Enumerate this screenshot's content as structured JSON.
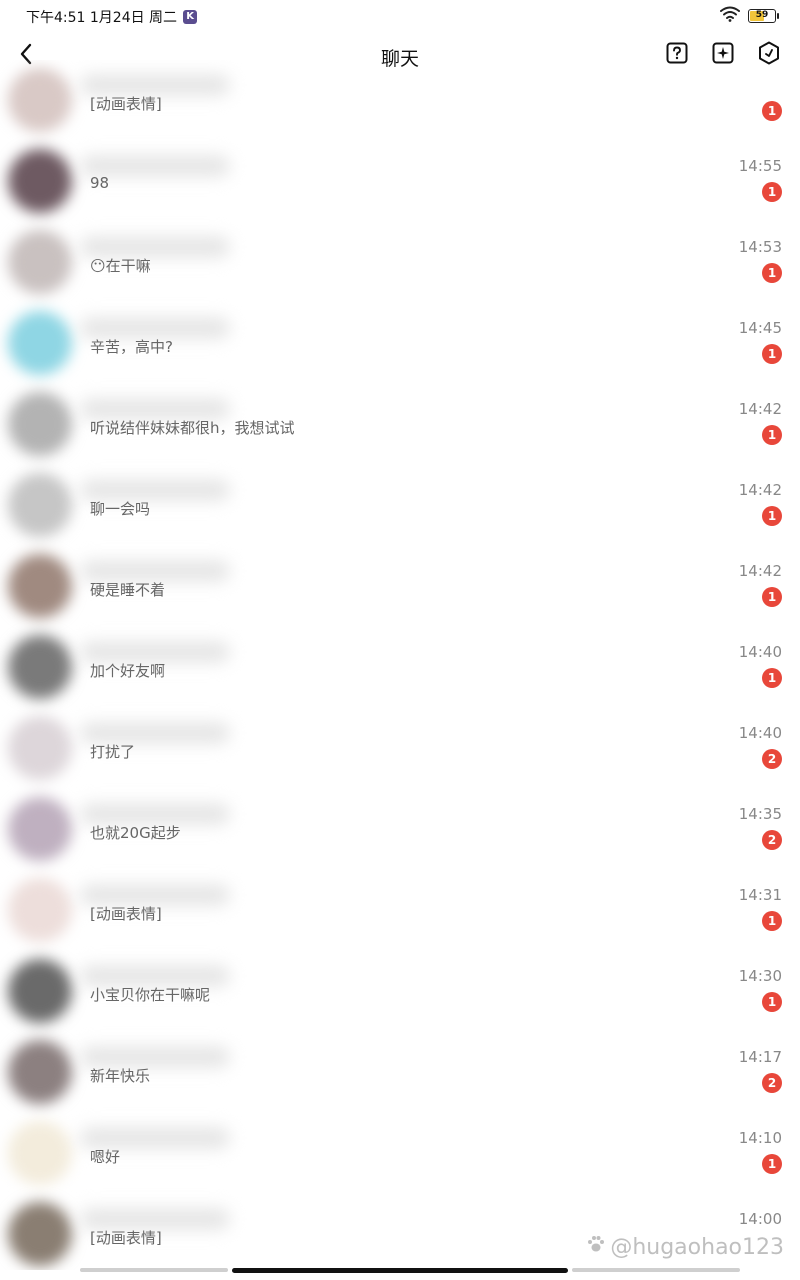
{
  "status_bar": {
    "time_date": "下午4:51  1月24日 周二",
    "app_badge": "K",
    "battery": "59",
    "battery_level": 0.59,
    "icons": [
      "wifi-icon",
      "battery-icon"
    ]
  },
  "nav": {
    "title": "聊天",
    "icons": [
      "back-arrow-icon",
      "help-square-icon",
      "add-square-icon",
      "settings-hex-icon"
    ]
  },
  "chats": [
    {
      "preview": "[动画表情]",
      "time": "",
      "unread": "1",
      "avatar_color": "#d9c9c6"
    },
    {
      "preview": "98",
      "time": "14:55",
      "unread": "1",
      "avatar_color": "#6e5a62"
    },
    {
      "preview": "😶在干嘛",
      "time": "14:53",
      "unread": "1",
      "avatar_color": "#c9c1c0"
    },
    {
      "preview": "辛苦，高中?",
      "time": "14:45",
      "unread": "1",
      "avatar_color": "#8fd6e4"
    },
    {
      "preview": "听说结伴妹妹都很h，我想试试",
      "time": "14:42",
      "unread": "1",
      "avatar_color": "#b3b3b3"
    },
    {
      "preview": "聊一会吗",
      "time": "14:42",
      "unread": "1",
      "avatar_color": "#c6c6c6"
    },
    {
      "preview": "硬是睡不着",
      "time": "14:42",
      "unread": "1",
      "avatar_color": "#a08a80"
    },
    {
      "preview": "加个好友啊",
      "time": "14:40",
      "unread": "1",
      "avatar_color": "#7a7a7a"
    },
    {
      "preview": "打扰了",
      "time": "14:40",
      "unread": "2",
      "avatar_color": "#ddd6da"
    },
    {
      "preview": "也就20G起步",
      "time": "14:35",
      "unread": "2",
      "avatar_color": "#bfb0c0"
    },
    {
      "preview": "[动画表情]",
      "time": "14:31",
      "unread": "1",
      "avatar_color": "#eddedb"
    },
    {
      "preview": "小宝贝你在干嘛呢",
      "time": "14:30",
      "unread": "1",
      "avatar_color": "#6a6a6a"
    },
    {
      "preview": "新年快乐",
      "time": "14:17",
      "unread": "2",
      "avatar_color": "#8c8080"
    },
    {
      "preview": "嗯好",
      "time": "14:10",
      "unread": "1",
      "avatar_color": "#f3ecdc"
    },
    {
      "preview": "[动画表情]",
      "time": "14:00",
      "unread": "",
      "avatar_color": "#8a7e72"
    }
  ],
  "watermark": "@hugaohao123"
}
